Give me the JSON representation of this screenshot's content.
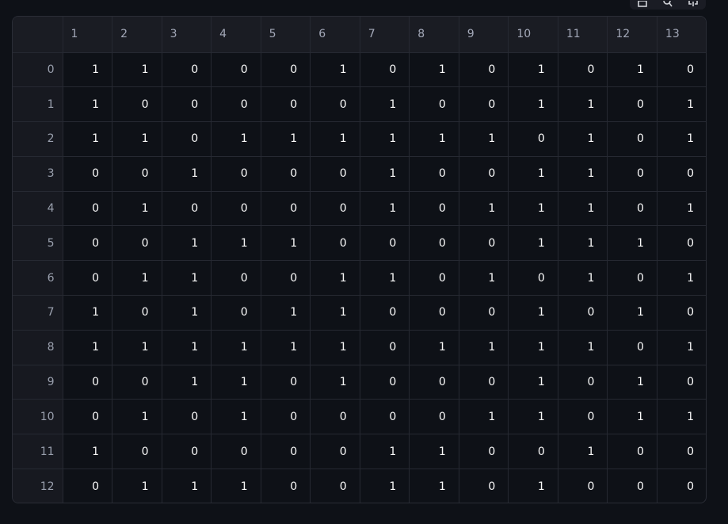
{
  "toolbar": {
    "icons": [
      "download-icon",
      "search-icon",
      "fullscreen-icon"
    ]
  },
  "table": {
    "columns": [
      "1",
      "2",
      "3",
      "4",
      "5",
      "6",
      "7",
      "8",
      "9",
      "10",
      "11",
      "12",
      "13"
    ],
    "rows": [
      {
        "index": "0",
        "cells": [
          "1",
          "1",
          "0",
          "0",
          "0",
          "1",
          "0",
          "1",
          "0",
          "1",
          "0",
          "1",
          "0"
        ]
      },
      {
        "index": "1",
        "cells": [
          "1",
          "0",
          "0",
          "0",
          "0",
          "0",
          "1",
          "0",
          "0",
          "1",
          "1",
          "0",
          "1"
        ]
      },
      {
        "index": "2",
        "cells": [
          "1",
          "1",
          "0",
          "1",
          "1",
          "1",
          "1",
          "1",
          "1",
          "0",
          "1",
          "0",
          "1"
        ]
      },
      {
        "index": "3",
        "cells": [
          "0",
          "0",
          "1",
          "0",
          "0",
          "0",
          "1",
          "0",
          "0",
          "1",
          "1",
          "0",
          "0"
        ]
      },
      {
        "index": "4",
        "cells": [
          "0",
          "1",
          "0",
          "0",
          "0",
          "0",
          "1",
          "0",
          "1",
          "1",
          "1",
          "0",
          "1"
        ]
      },
      {
        "index": "5",
        "cells": [
          "0",
          "0",
          "1",
          "1",
          "1",
          "0",
          "0",
          "0",
          "0",
          "1",
          "1",
          "1",
          "0"
        ]
      },
      {
        "index": "6",
        "cells": [
          "0",
          "1",
          "1",
          "0",
          "0",
          "1",
          "1",
          "0",
          "1",
          "0",
          "1",
          "0",
          "1"
        ]
      },
      {
        "index": "7",
        "cells": [
          "1",
          "0",
          "1",
          "0",
          "1",
          "1",
          "0",
          "0",
          "0",
          "1",
          "0",
          "1",
          "0"
        ]
      },
      {
        "index": "8",
        "cells": [
          "1",
          "1",
          "1",
          "1",
          "1",
          "1",
          "0",
          "1",
          "1",
          "1",
          "1",
          "0",
          "1"
        ]
      },
      {
        "index": "9",
        "cells": [
          "0",
          "0",
          "1",
          "1",
          "0",
          "1",
          "0",
          "0",
          "0",
          "1",
          "0",
          "1",
          "0"
        ]
      },
      {
        "index": "10",
        "cells": [
          "0",
          "1",
          "0",
          "1",
          "0",
          "0",
          "0",
          "0",
          "1",
          "1",
          "0",
          "1",
          "1"
        ]
      },
      {
        "index": "11",
        "cells": [
          "1",
          "0",
          "0",
          "0",
          "0",
          "0",
          "1",
          "1",
          "0",
          "0",
          "1",
          "0",
          "0"
        ]
      },
      {
        "index": "12",
        "cells": [
          "0",
          "1",
          "1",
          "1",
          "0",
          "0",
          "1",
          "1",
          "0",
          "1",
          "0",
          "0",
          "0"
        ]
      }
    ]
  }
}
